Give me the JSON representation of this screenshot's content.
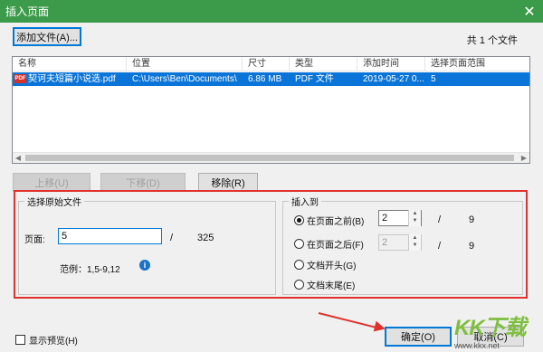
{
  "window": {
    "title": "插入页面",
    "close_glyph": "✕"
  },
  "toolbar": {
    "add_file_label": "添加文件(A)...",
    "file_count": "共 1 个文件"
  },
  "filelist": {
    "columns": [
      "名称",
      "位置",
      "尺寸",
      "类型",
      "添加时间",
      "选择页面范围"
    ],
    "rows": [
      {
        "icon": "PDF",
        "name": "契诃夫短篇小说选.pdf",
        "location": "C:\\Users\\Ben\\Documents\\",
        "size": "6.86 MB",
        "type": "PDF 文件",
        "added": "2019-05-27 0...",
        "range": "5"
      }
    ]
  },
  "list_buttons": {
    "up": "上移(U)",
    "down": "下移(D)",
    "remove": "移除(R)"
  },
  "source": {
    "group_title": "选择原始文件",
    "page_label": "页面:",
    "page_value": "5",
    "slash": "/",
    "total": "325",
    "example": "范例：1,5-9,12"
  },
  "insert": {
    "group_title": "插入到",
    "before_label": "在页面之前(B)",
    "before_value": "2",
    "after_label": "在页面之后(F)",
    "after_value": "2",
    "slash": "/",
    "total": "9",
    "start_label": "文档开头(G)",
    "end_label": "文档末尾(E)",
    "selected": "before"
  },
  "footer": {
    "preview_label": "显示预览(H)",
    "ok_label": "确定(O)",
    "cancel_label": "取消(C)"
  },
  "watermark": {
    "logo": "KK下载",
    "url": "www.kkx.net"
  },
  "colors": {
    "titlebar": "#3c9b4a",
    "selection": "#0a74d8",
    "annotation": "#e0312f"
  }
}
